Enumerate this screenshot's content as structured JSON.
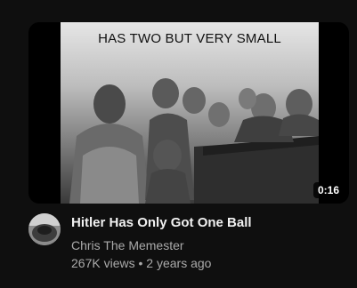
{
  "video": {
    "thumbnail_caption": "HAS TWO BUT VERY SMALL",
    "duration": "0:16",
    "title": "Hitler Has Only Got One Ball",
    "channel": "Chris The Memester",
    "views": "267K views",
    "separator": "•",
    "age": "2 years ago"
  },
  "icons": {
    "avatar": "channel-avatar-image"
  },
  "colors": {
    "background": "#0f0f0f",
    "title": "#f1f1f1",
    "secondary_text": "#aaaaaa",
    "duration_badge": "#000000"
  }
}
